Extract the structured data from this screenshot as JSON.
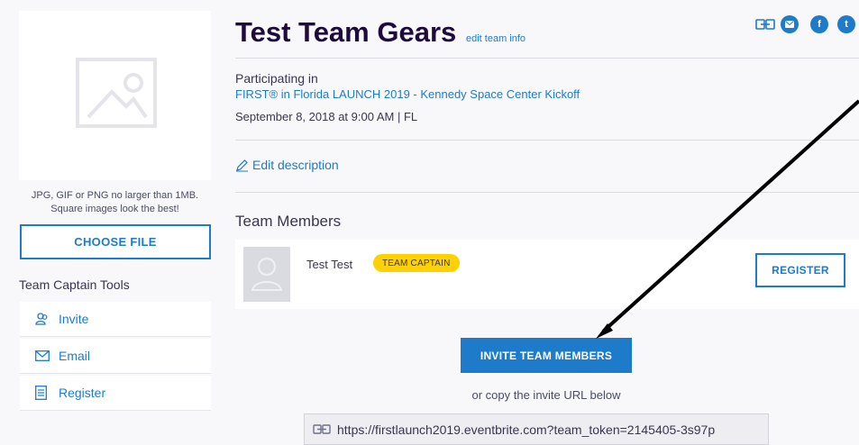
{
  "left": {
    "photo_hint": "JPG, GIF or PNG no larger than 1MB. Square images look the best!",
    "choose_file_label": "CHOOSE FILE",
    "tools_title": "Team Captain Tools",
    "tools": [
      {
        "label": "Invite",
        "icon": "invite-people-icon"
      },
      {
        "label": "Email",
        "icon": "envelope-icon"
      },
      {
        "label": "Register",
        "icon": "register-list-icon"
      }
    ]
  },
  "header": {
    "team_name": "Test Team Gears",
    "edit_link": "edit team info",
    "share_icons": [
      "link-icon",
      "email-share-icon",
      "facebook-icon",
      "twitter-icon"
    ],
    "share_glyphs": {
      "facebook": "f",
      "twitter": "t"
    }
  },
  "event": {
    "participating_label": "Participating in",
    "name": "FIRST® in Florida LAUNCH 2019 - Kennedy Space Center Kickoff",
    "date": "September 8, 2018 at 9:00 AM | FL"
  },
  "description": {
    "edit_label": "Edit description"
  },
  "members": {
    "title": "Team Members",
    "list": [
      {
        "name": "Test Test",
        "badge": "TEAM CAPTAIN",
        "action": "REGISTER"
      }
    ]
  },
  "invite": {
    "button_label": "INVITE TEAM MEMBERS",
    "copy_text": "or copy the invite URL below",
    "url": "https://firstlaunch2019.eventbrite.com?team_token=2145405-3s97p"
  },
  "colors": {
    "accent": "#1e7bc9",
    "badge": "#ffd100",
    "annotation_arrow": "#000000"
  }
}
